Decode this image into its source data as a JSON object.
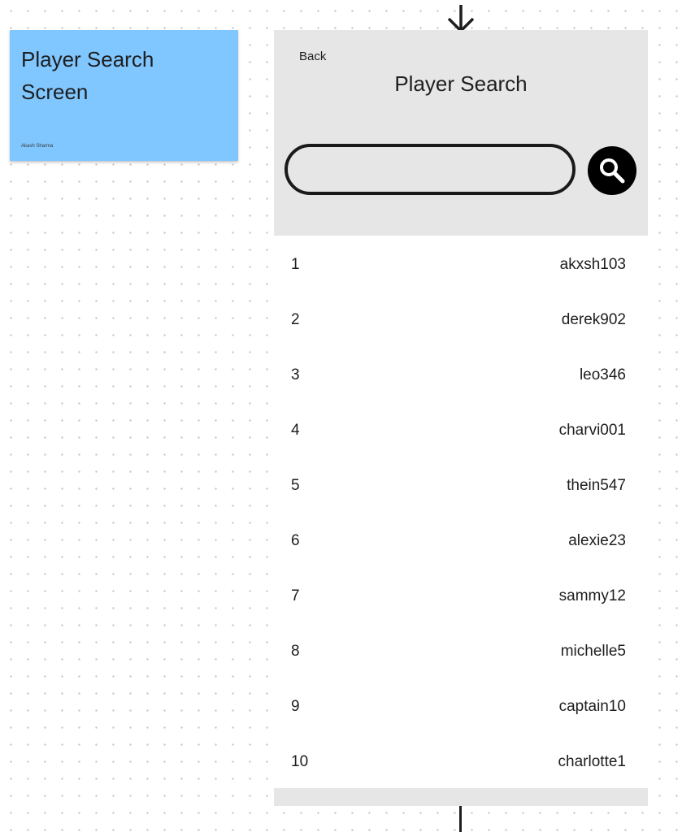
{
  "sticky_note": {
    "title": "Player Search Screen",
    "author": "Akash Sharma",
    "color": "#80c6ff"
  },
  "screen": {
    "back_label": "Back",
    "title": "Player Search",
    "search": {
      "value": "",
      "placeholder": "",
      "button_icon": "search-icon"
    },
    "players": [
      {
        "rank": "1",
        "username": "akxsh103"
      },
      {
        "rank": "2",
        "username": "derek902"
      },
      {
        "rank": "3",
        "username": "leo346"
      },
      {
        "rank": "4",
        "username": "charvi001"
      },
      {
        "rank": "5",
        "username": "thein547"
      },
      {
        "rank": "6",
        "username": "alexie23"
      },
      {
        "rank": "7",
        "username": "sammy12"
      },
      {
        "rank": "8",
        "username": "michelle5"
      },
      {
        "rank": "9",
        "username": "captain10"
      },
      {
        "rank": "10",
        "username": "charlotte1"
      }
    ]
  },
  "colors": {
    "header_bg": "#e6e6e6",
    "canvas_dot": "#c9c9c9",
    "button_bg": "#000000",
    "text": "#1e1e1e"
  }
}
